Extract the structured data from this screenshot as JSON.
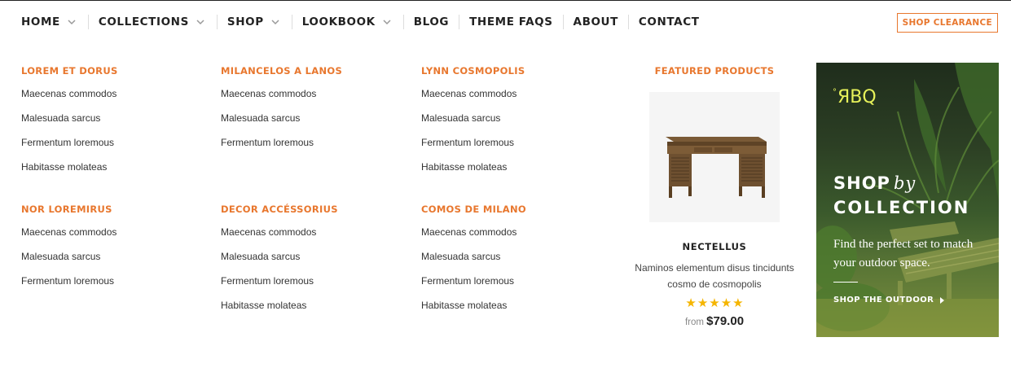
{
  "nav": {
    "items": [
      {
        "label": "HOME",
        "has_dropdown": true
      },
      {
        "label": "COLLECTIONS",
        "has_dropdown": true
      },
      {
        "label": "SHOP",
        "has_dropdown": true
      },
      {
        "label": "LOOKBOOK",
        "has_dropdown": true
      },
      {
        "label": "BLOG",
        "has_dropdown": false
      },
      {
        "label": "THEME FAQS",
        "has_dropdown": false
      },
      {
        "label": "ABOUT",
        "has_dropdown": false
      },
      {
        "label": "CONTACT",
        "has_dropdown": false
      }
    ],
    "clearance_label": "SHOP CLEARANCE"
  },
  "menu": {
    "columns": [
      {
        "title": "LOREM ET DORUS",
        "links": [
          "Maecenas commodos",
          "Malesuada sarcus",
          "Fermentum loremous",
          "Habitasse molateas"
        ]
      },
      {
        "title": "MILANCELOS A LANOS",
        "links": [
          "Maecenas commodos",
          "Malesuada sarcus",
          "Fermentum loremous"
        ]
      },
      {
        "title": "LYNN COSMOPOLIS",
        "links": [
          "Maecenas commodos",
          "Malesuada sarcus",
          "Fermentum loremous",
          "Habitasse molateas"
        ]
      },
      {
        "title": "NOR LOREMIRUS",
        "links": [
          "Maecenas commodos",
          "Malesuada sarcus",
          "Fermentum loremous"
        ]
      },
      {
        "title": "DECOR ACCÉSSORIUS",
        "links": [
          "Maecenas commodos",
          "Malesuada sarcus",
          "Fermentum loremous",
          "Habitasse molateas"
        ]
      },
      {
        "title": "COMOS DE MILANO",
        "links": [
          "Maecenas commodos",
          "Malesuada sarcus",
          "Fermentum loremous",
          "Habitasse molateas"
        ]
      }
    ]
  },
  "featured": {
    "title": "FEATURED PRODUCTS",
    "product": {
      "image_icon": "wooden-desk-image",
      "name": "NECTELLUS",
      "description": "Naminos elementum disus tincidunts cosmo de cosmopolis",
      "rating": 5,
      "rating_max": 5,
      "price_prefix": "from",
      "price": "$79.00"
    }
  },
  "banner": {
    "logo": "ЯBQ",
    "logo_dot": "°",
    "heading_shop": "SHOP",
    "heading_by": "by",
    "heading_collection": "COLLECTION",
    "text": "Find the perfect set to match your outdoor space.",
    "link_label": "SHOP THE OUTDOOR"
  },
  "colors": {
    "accent": "#e8772e",
    "star": "#f5b500",
    "logo": "#e7f25a"
  }
}
